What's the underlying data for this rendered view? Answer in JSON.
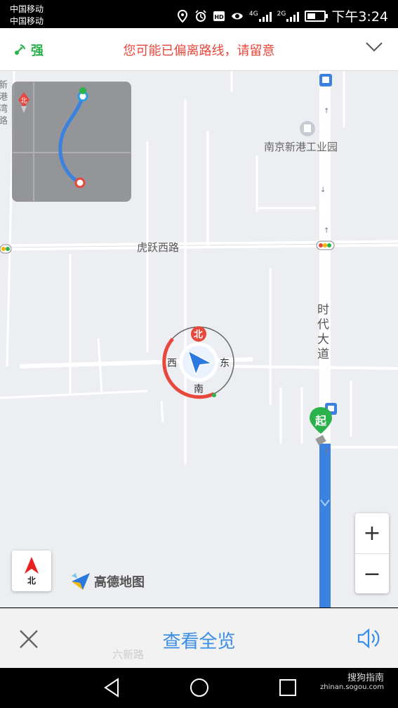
{
  "status_bar": {
    "carrier_1": "中国移动",
    "carrier_2": "中国移动",
    "net_1": "4G",
    "net_2": "2G",
    "time": "下午3:24",
    "icons": [
      "location-icon",
      "alarm-icon",
      "hd-icon",
      "eye-icon",
      "battery-icon"
    ]
  },
  "top_bar": {
    "gps_strength": "强",
    "warning": "您可能已偏离路线，请留意"
  },
  "map": {
    "labels": {
      "industrial_park": "南京新港工业园",
      "road_huyue": "虎跃西路",
      "road_shidai": "时代大道",
      "road_left_edge": "新港湾路"
    },
    "heading_dial": {
      "north": "北",
      "south": "南",
      "east": "东",
      "west": "西"
    },
    "start_marker": "起",
    "compass_label": "北",
    "logo_text": "高德地图",
    "zoom_in": "+",
    "zoom_out": "−"
  },
  "bottom_bar": {
    "overview": "查看全览",
    "road_faded": "六新路"
  },
  "nav_bar": {
    "watermark_name": "搜狗指南",
    "watermark_url": "zhinan.sogou.com"
  },
  "colors": {
    "route_blue": "#3b82e0",
    "warning_red": "#e8473c",
    "gps_green": "#2bb24c",
    "accent_blue": "#3a8ee6"
  }
}
